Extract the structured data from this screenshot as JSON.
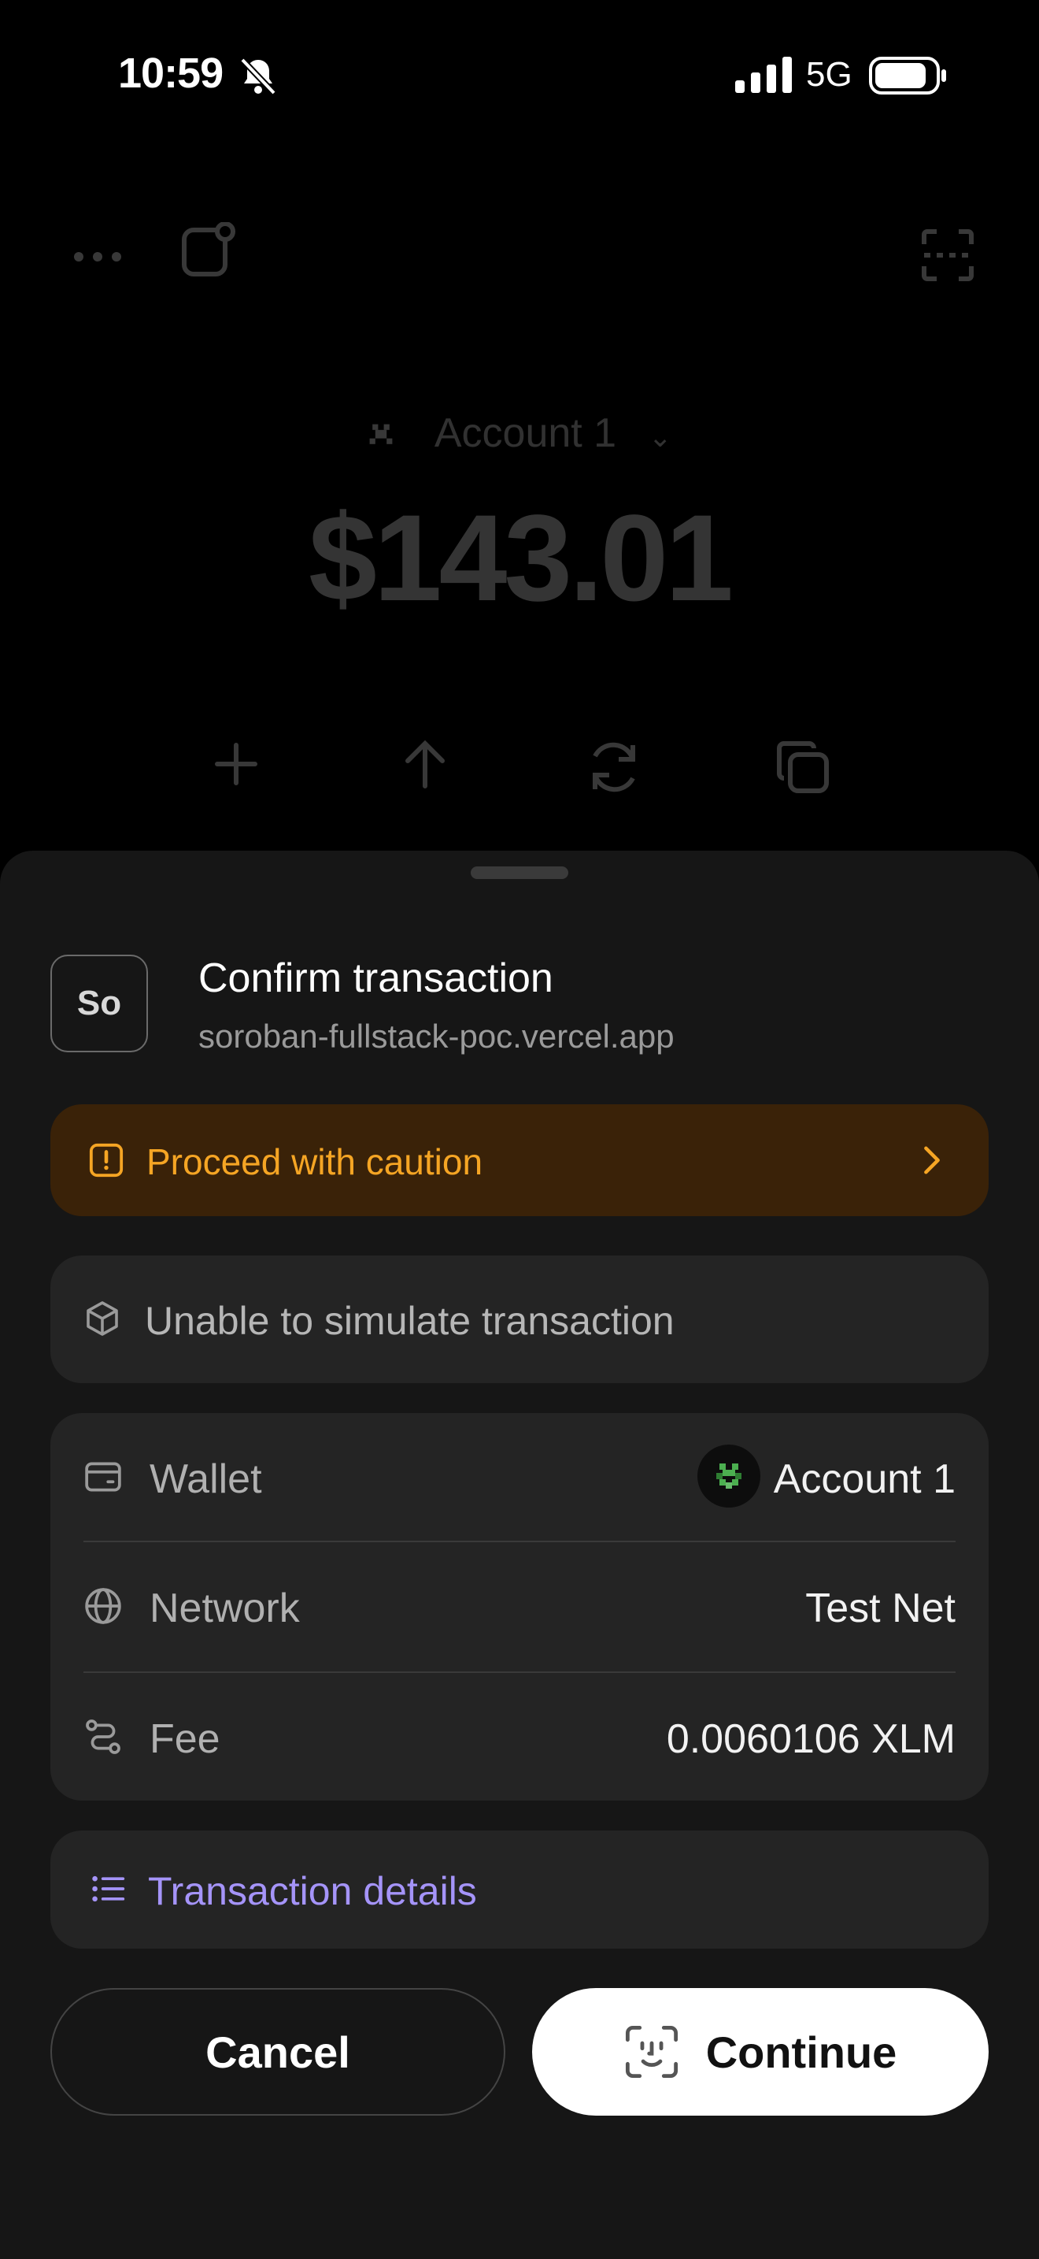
{
  "status_bar": {
    "time": "10:59",
    "network": "5G",
    "icons": [
      "bell-slash-icon",
      "signal-icon",
      "battery-icon"
    ]
  },
  "background_wallet": {
    "toolbar_icons": [
      "more-icon",
      "notes-icon",
      "scan-icon"
    ],
    "account_name": "Account 1",
    "balance": "$143.01",
    "actions": [
      "plus-icon",
      "arrow-up-icon",
      "swap-icon",
      "copy-icon"
    ]
  },
  "sheet": {
    "site_badge": "So",
    "title": "Confirm transaction",
    "domain": "soroban-fullstack-poc.vercel.app",
    "caution": {
      "label": "Proceed with caution",
      "color": "#f5a524"
    },
    "simulation": {
      "label": "Unable to simulate transaction"
    },
    "rows": [
      {
        "label": "Wallet",
        "value": "Account 1",
        "icon": "wallet-icon"
      },
      {
        "label": "Network",
        "value": "Test Net",
        "icon": "globe-icon"
      },
      {
        "label": "Fee",
        "value": "0.0060106 XLM",
        "icon": "route-icon"
      }
    ],
    "details": {
      "label": "Transaction details",
      "color": "#a594f9"
    },
    "buttons": {
      "cancel": "Cancel",
      "continue": "Continue"
    }
  }
}
